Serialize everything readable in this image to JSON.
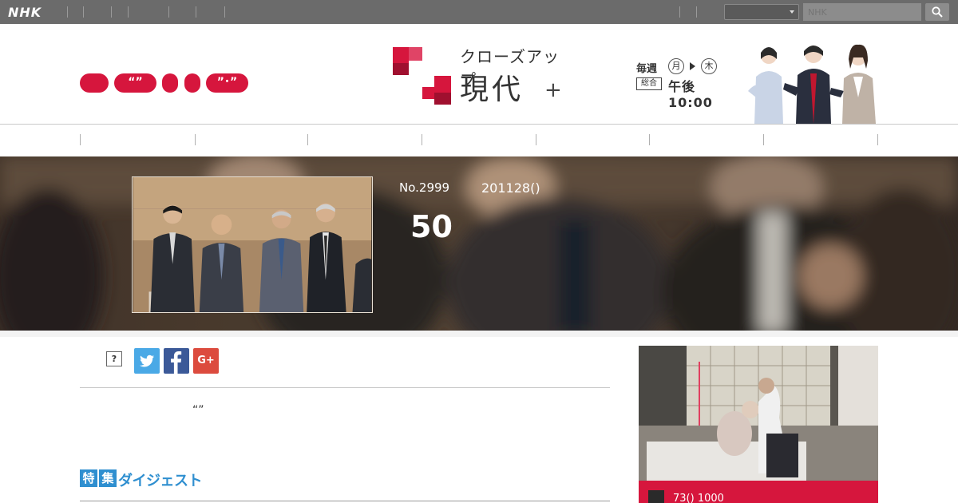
{
  "topbar": {
    "logo": "NHK",
    "search_placeholder": "NHK",
    "select_value": ""
  },
  "header": {
    "pills": [
      "",
      "“”",
      "",
      "",
      "”･”"
    ],
    "logo_small": "クローズアップ",
    "logo_main": "現代",
    "logo_plus": "+",
    "schedule": {
      "weekly": "毎週",
      "from_day": "月",
      "to_day": "木",
      "channel": "総合",
      "time": "午後 10:00"
    }
  },
  "nav": {
    "items": [
      "",
      "",
      "",
      "",
      "",
      "",
      "",
      ""
    ]
  },
  "episode": {
    "number": "No.2999",
    "date": "201128()",
    "title": "50"
  },
  "share": {
    "help": "?",
    "twitter_icon": "twitter-icon",
    "facebook_icon": "facebook-icon",
    "gplus_label": "G+"
  },
  "body": {
    "quote": "“”"
  },
  "digest": {
    "tag1": "特",
    "tag2": "集",
    "label": "ダイジェスト"
  },
  "side": {
    "caption": "73() 1000"
  },
  "colors": {
    "accent_red": "#d6163d",
    "digest_blue": "#2f8fd0",
    "topbar_gray": "#6b6b6b"
  }
}
